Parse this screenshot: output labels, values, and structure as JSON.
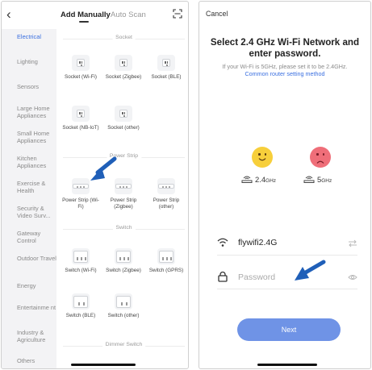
{
  "left": {
    "tabs": {
      "active": "Add Manually",
      "inactive": "Auto Scan"
    },
    "categories": [
      "Electrical",
      "Lighting",
      "Sensors",
      "Large Home Appliances",
      "Small Home Appliances",
      "Kitchen Appliances",
      "Exercise & Health",
      "Security & Video Surv...",
      "Gateway Control",
      "Outdoor Travel",
      "Energy",
      "Entertainme nt",
      "Industry & Agriculture",
      "Others"
    ],
    "sections": {
      "socket": "Socket",
      "power_strip": "Power Strip",
      "switch": "Switch",
      "dimmer_switch": "Dimmer Switch"
    },
    "devices": {
      "socket_wifi": "Socket (Wi-Fi)",
      "socket_zigbee": "Socket (Zigbee)",
      "socket_ble": "Socket (BLE)",
      "socket_nbiot": "Socket (NB-IoT)",
      "socket_other": "Socket (other)",
      "strip_wifi": "Power Strip (Wi-Fi)",
      "strip_zigbee": "Power Strip (Zigbee)",
      "strip_other": "Power Strip (other)",
      "switch_wifi": "Switch (Wi-Fi)",
      "switch_zigbee": "Switch (Zigbee)",
      "switch_gprs": "Switch (GPRS)",
      "switch_ble": "Switch (BLE)",
      "switch_other": "Switch (other)"
    }
  },
  "right": {
    "cancel": "Cancel",
    "title_line1": "Select 2.4 GHz Wi-Fi Network and",
    "title_line2": "enter password.",
    "hint": "If your Wi-Fi is 5GHz, please set it to be 2.4GHz.",
    "link": "Common router setting method",
    "band_good": "2.4",
    "band_bad": "5",
    "band_unit": "GHz",
    "wifi_name": "flywifi2.4G",
    "password_placeholder": "Password",
    "next": "Next"
  },
  "colors": {
    "accent_blue": "#3a6fe0",
    "next_button": "#6f93e6",
    "arrow": "#1f5fb8",
    "happy_face": "#f7cf3b",
    "sad_face": "#ef6e79"
  }
}
